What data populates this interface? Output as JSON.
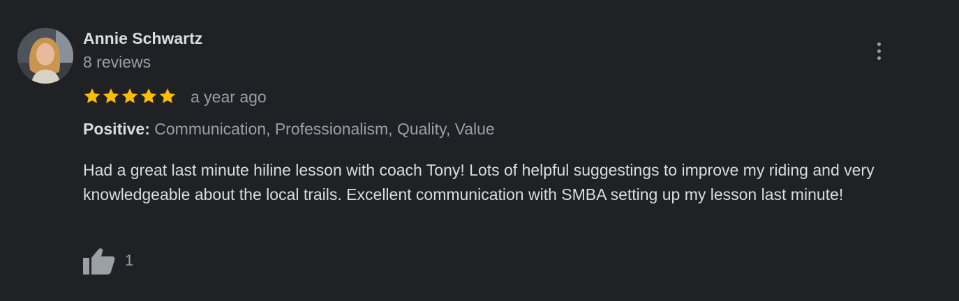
{
  "review": {
    "reviewer_name": "Annie Schwartz",
    "review_count": "8 reviews",
    "rating": 5,
    "rating_max": 5,
    "time": "a year ago",
    "attributes_label": "Positive:",
    "attributes_value": " Communication, Professionalism, Quality, Value",
    "text": "Had a great last minute hiline lesson with coach Tony! Lots of helpful suggestings to improve my riding and very knowledgeable about the local trails. Excellent communication with SMBA setting up my lesson last minute!",
    "like_count": "1"
  },
  "icons": {
    "more": "more-vert-icon",
    "star": "star-icon",
    "like": "thumb-up-icon"
  },
  "colors": {
    "background": "#202124",
    "star": "#fbbc04",
    "text_primary": "#dadce0",
    "text_secondary": "#9aa0a6"
  }
}
